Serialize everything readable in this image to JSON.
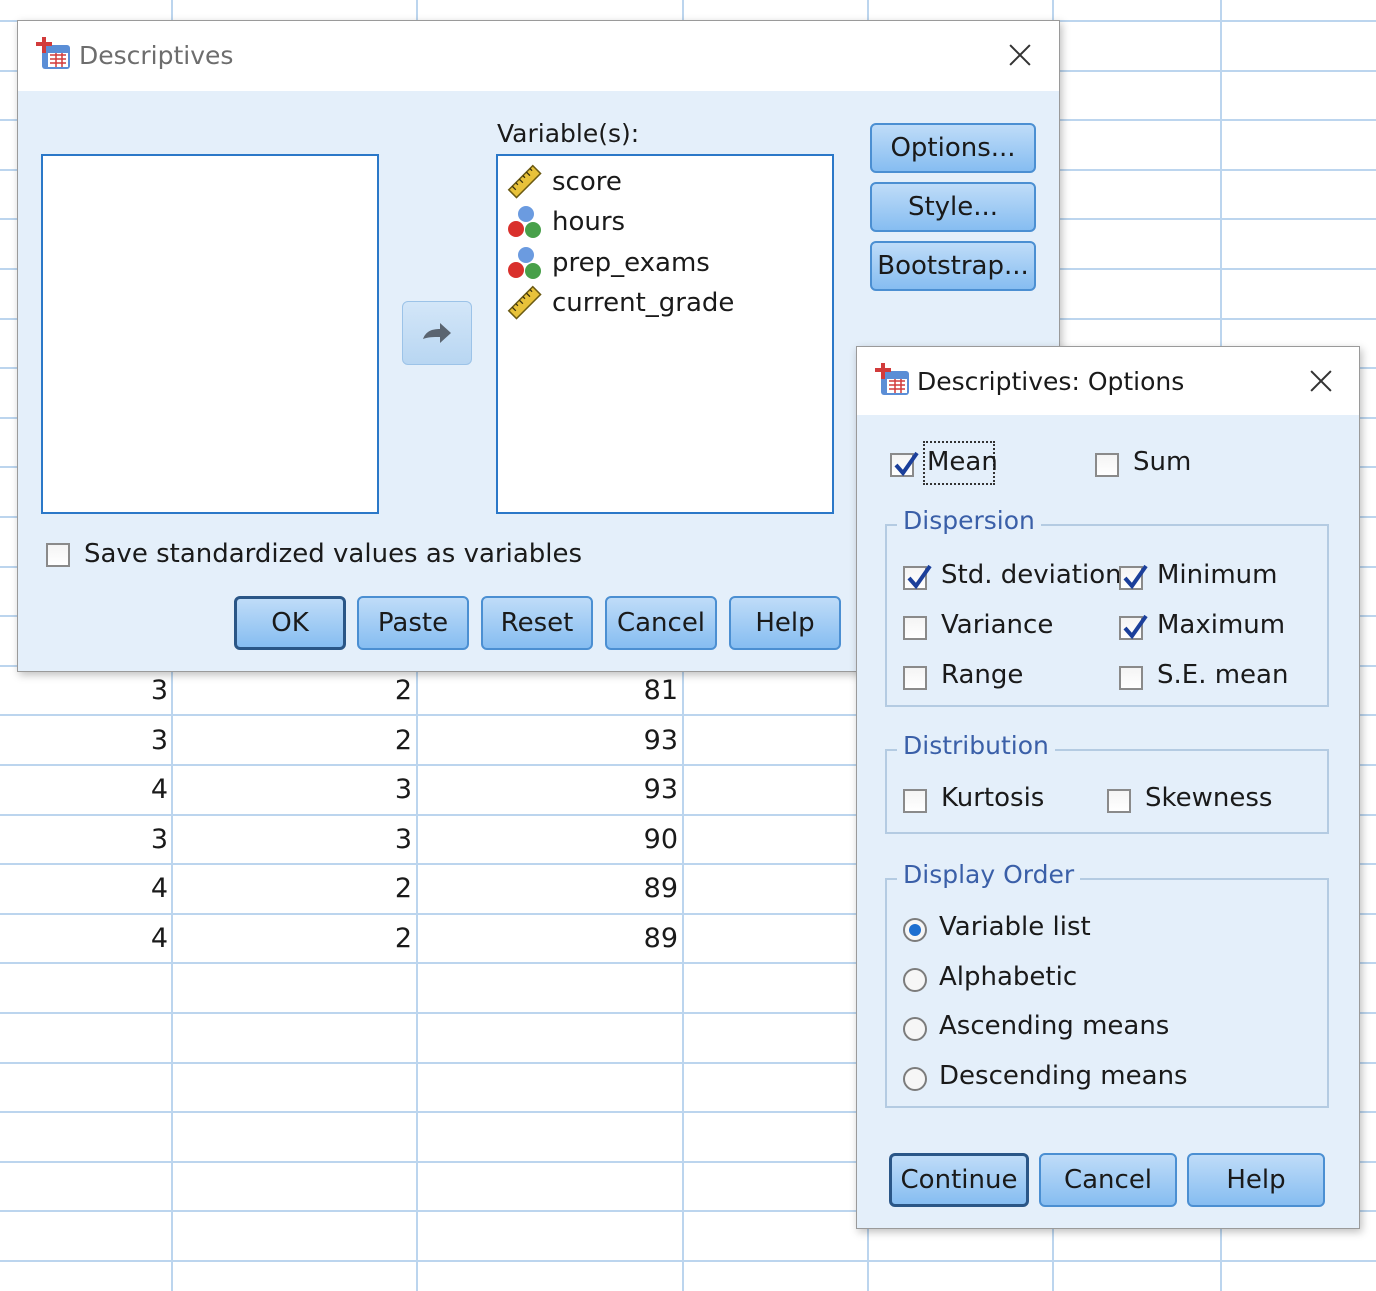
{
  "spreadsheet": {
    "rows": [
      [
        "3",
        "2",
        "81"
      ],
      [
        "3",
        "2",
        "93"
      ],
      [
        "4",
        "3",
        "93"
      ],
      [
        "3",
        "3",
        "90"
      ],
      [
        "4",
        "2",
        "89"
      ],
      [
        "4",
        "2",
        "89"
      ]
    ]
  },
  "descriptives": {
    "title": "Descriptives",
    "variables_label": "Variable(s):",
    "variables": [
      {
        "name": "score",
        "icon": "scale-ruler-icon"
      },
      {
        "name": "hours",
        "icon": "nominal-balls-icon"
      },
      {
        "name": "prep_exams",
        "icon": "nominal-balls-icon"
      },
      {
        "name": "current_grade",
        "icon": "scale-ruler-icon"
      }
    ],
    "save_standardized_label": "Save standardized values as variables",
    "side_buttons": {
      "options": "Options...",
      "style": "Style...",
      "bootstrap": "Bootstrap..."
    },
    "buttons": {
      "ok": "OK",
      "paste": "Paste",
      "reset": "Reset",
      "cancel": "Cancel",
      "help": "Help"
    }
  },
  "options": {
    "title": "Descriptives: Options",
    "mean": {
      "label": "Mean",
      "checked": true
    },
    "sum": {
      "label": "Sum",
      "checked": false
    },
    "dispersion": {
      "title": "Dispersion",
      "std_deviation": {
        "label": "Std. deviation",
        "checked": true
      },
      "minimum": {
        "label": "Minimum",
        "checked": true
      },
      "variance": {
        "label": "Variance",
        "checked": false
      },
      "maximum": {
        "label": "Maximum",
        "checked": true
      },
      "range": {
        "label": "Range",
        "checked": false
      },
      "se_mean": {
        "label": "S.E. mean",
        "checked": false
      }
    },
    "distribution": {
      "title": "Distribution",
      "kurtosis": {
        "label": "Kurtosis",
        "checked": false
      },
      "skewness": {
        "label": "Skewness",
        "checked": false
      }
    },
    "display_order": {
      "title": "Display Order",
      "selected": "Variable list",
      "options": [
        "Variable list",
        "Alphabetic",
        "Ascending means",
        "Descending means"
      ]
    },
    "buttons": {
      "continue": "Continue",
      "cancel": "Cancel",
      "help": "Help"
    }
  },
  "colors": {
    "dialog_bg": "#e4effa",
    "button_fill": "#86bdf1",
    "grid_line": "#bcd5ee",
    "group_title": "#3a5fa8"
  }
}
